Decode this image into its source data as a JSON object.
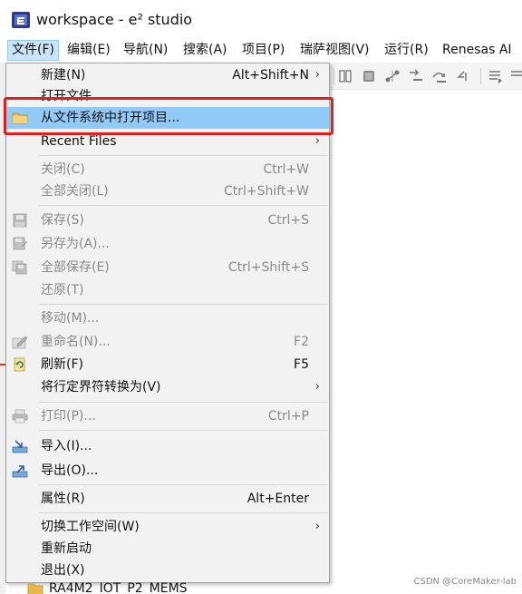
{
  "window": {
    "title": "workspace - e² studio"
  },
  "menubar": {
    "items": [
      {
        "label": "文件(F)"
      },
      {
        "label": "编辑(E)"
      },
      {
        "label": "导航(N)"
      },
      {
        "label": "搜索(A)"
      },
      {
        "label": "项目(P)"
      },
      {
        "label": "瑞萨视图(V)"
      },
      {
        "label": "运行(R)"
      },
      {
        "label": "Renesas AI"
      }
    ]
  },
  "file_menu": {
    "items": [
      {
        "label": "新建(N)",
        "shortcut": "Alt+Shift+N",
        "submenu": true,
        "disabled": false
      },
      {
        "label": "打开文件",
        "shortcut": "",
        "submenu": false,
        "disabled": false
      },
      {
        "label": "从文件系统中打开项目...",
        "shortcut": "",
        "submenu": false,
        "disabled": false,
        "icon": "folder-icon"
      },
      {
        "label": "Recent Files",
        "shortcut": "",
        "submenu": true,
        "disabled": false
      },
      {
        "label": "关闭(C)",
        "shortcut": "Ctrl+W",
        "submenu": false,
        "disabled": true
      },
      {
        "label": "全部关闭(L)",
        "shortcut": "Ctrl+Shift+W",
        "submenu": false,
        "disabled": true
      },
      {
        "label": "保存(S)",
        "shortcut": "Ctrl+S",
        "submenu": false,
        "disabled": true,
        "icon": "save-icon"
      },
      {
        "label": "另存为(A)...",
        "shortcut": "",
        "submenu": false,
        "disabled": true,
        "icon": "save-as-icon"
      },
      {
        "label": "全部保存(E)",
        "shortcut": "Ctrl+Shift+S",
        "submenu": false,
        "disabled": true,
        "icon": "save-all-icon"
      },
      {
        "label": "还原(T)",
        "shortcut": "",
        "submenu": false,
        "disabled": true
      },
      {
        "label": "移动(M)...",
        "shortcut": "",
        "submenu": false,
        "disabled": true
      },
      {
        "label": "重命名(N)...",
        "shortcut": "F2",
        "submenu": false,
        "disabled": true,
        "icon": "rename-icon"
      },
      {
        "label": "刷新(F)",
        "shortcut": "F5",
        "submenu": false,
        "disabled": false,
        "icon": "refresh-icon"
      },
      {
        "label": "将行定界符转换为(V)",
        "shortcut": "",
        "submenu": true,
        "disabled": false
      },
      {
        "label": "打印(P)...",
        "shortcut": "Ctrl+P",
        "submenu": false,
        "disabled": true,
        "icon": "print-icon"
      },
      {
        "label": "导入(I)...",
        "shortcut": "",
        "submenu": false,
        "disabled": false,
        "icon": "import-icon"
      },
      {
        "label": "导出(O)...",
        "shortcut": "",
        "submenu": false,
        "disabled": false,
        "icon": "export-icon"
      },
      {
        "label": "属性(R)",
        "shortcut": "Alt+Enter",
        "submenu": false,
        "disabled": false
      },
      {
        "label": "切换工作空间(W)",
        "shortcut": "",
        "submenu": true,
        "disabled": false
      },
      {
        "label": "重新启动",
        "shortcut": "",
        "submenu": false,
        "disabled": false
      },
      {
        "label": "退出(X)",
        "shortcut": "",
        "submenu": false,
        "disabled": false
      }
    ],
    "submenu_arrow": "›"
  },
  "background": {
    "project_item": "RA4M2_IOT_P2_MEMS"
  },
  "watermark": "CSDN @CoreMaker-lab",
  "colors": {
    "highlight": "#91c9f7",
    "annotation_box": "#e02020",
    "menu_bg": "#f2f2f2"
  }
}
